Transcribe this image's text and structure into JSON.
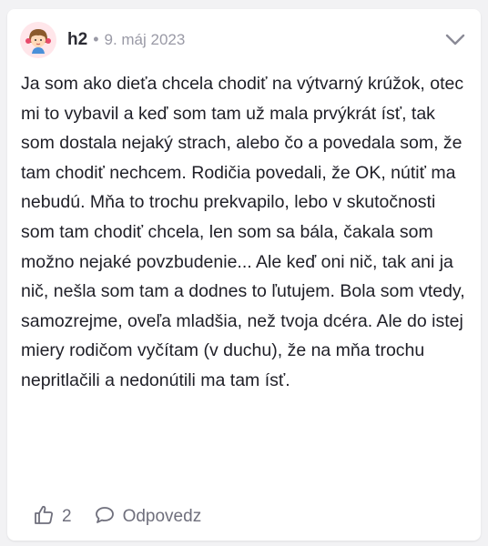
{
  "post": {
    "username": "h2",
    "separator": "•",
    "date": "9. máj 2023",
    "avatar_icon": "girl-avatar-icon",
    "menu_icon": "chevron-down-icon",
    "text": "Ja som ako dieťa chcela chodiť na výtvarný krúžok, otec mi to vybavil a keď som tam už mala prvýkrát ísť, tak som dostala nejaký strach, alebo čo a povedala som, že tam chodiť nechcem. Rodičia povedali, že OK, nútiť ma nebudú. Mňa to trochu prekvapilo, lebo v skutočnosti som tam chodiť chcela, len som sa bála, čakala som možno nejaké povzbudenie... Ale keď oni nič, tak ani ja nič, nešla som tam a dodnes to ľutujem. Bola som vtedy, samozrejme, oveľa mladšia, než tvoja dcéra. Ale do istej miery rodičom vyčítam (v duchu), že na mňa trochu nepritlačili a nedonútili ma tam ísť."
  },
  "actions": {
    "like_icon": "thumbs-up-icon",
    "like_count": "2",
    "reply_icon": "speech-bubble-icon",
    "reply_label": "Odpovedz"
  },
  "colors": {
    "background": "#f2f2f4",
    "card": "#ffffff",
    "text": "#1f1f27",
    "muted": "#9a9aa6",
    "icon": "#6f6f7c"
  }
}
